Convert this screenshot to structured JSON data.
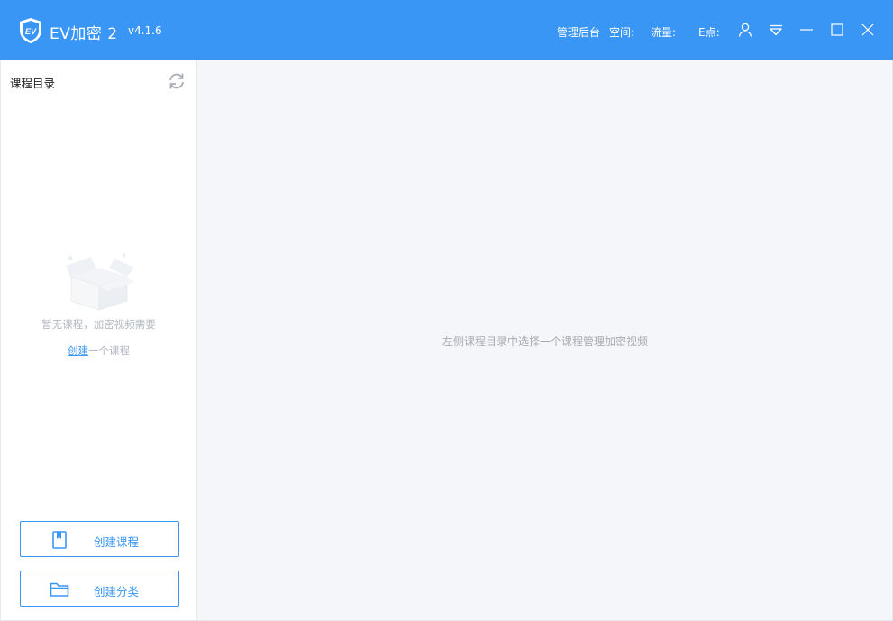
{
  "titlebar": {
    "app_title": "EV加密 2",
    "version": "v4.1.6",
    "admin_link": "管理后台",
    "space_label": "空间:",
    "traffic_label": "流量:",
    "points_label": "E点:",
    "icons": [
      "user-icon",
      "dropdown-menu-icon",
      "minimize-icon",
      "maximize-icon",
      "close-icon"
    ],
    "logo_text": "EV"
  },
  "sidebar": {
    "title": "课程目录",
    "empty_line1": "暂无课程，加密视频需要",
    "empty_link": "创建",
    "empty_line2_rest": "一个课程",
    "buttons": [
      {
        "label": "创建课程",
        "icon": "book-icon"
      },
      {
        "label": "创建分类",
        "icon": "folder-icon"
      }
    ]
  },
  "main": {
    "hint": "左侧课程目录中选择一个课程管理加密视频"
  },
  "colors": {
    "accent": "#3a96f5",
    "main_bg": "#f5f6fa",
    "muted_text": "#a6abb3"
  }
}
